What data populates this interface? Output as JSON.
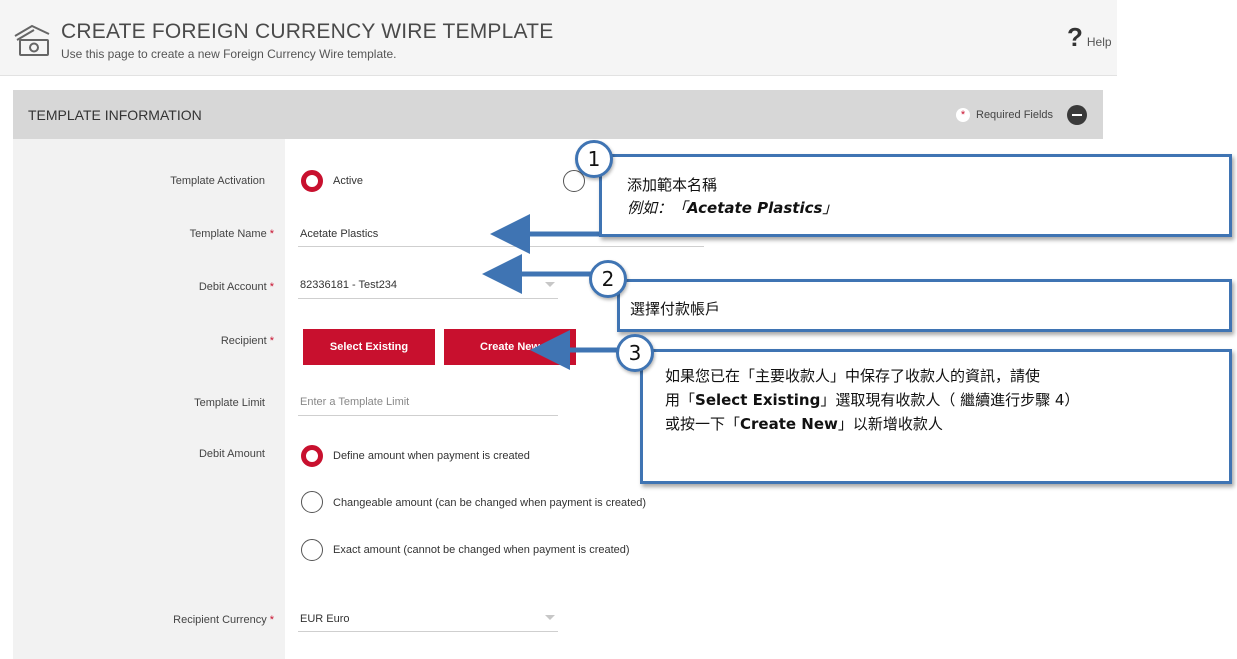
{
  "header": {
    "title": "CREATE FOREIGN CURRENCY WIRE TEMPLATE",
    "subtitle": "Use this page to create a new Foreign Currency Wire template.",
    "help_icon": "?",
    "help_label": "Help"
  },
  "section": {
    "title": "TEMPLATE INFORMATION",
    "required_label": "Required Fields",
    "required_star": "*"
  },
  "form": {
    "activation": {
      "label": "Template Activation",
      "option_active": "Active"
    },
    "template_name": {
      "label": "Template Name",
      "value": "Acetate Plastics"
    },
    "debit_account": {
      "label": "Debit Account",
      "value": "82336181 - Test234"
    },
    "recipient": {
      "label": "Recipient",
      "select_existing": "Select Existing",
      "create_new": "Create New"
    },
    "template_limit": {
      "label": "Template Limit",
      "placeholder": "Enter a Template Limit"
    },
    "debit_amount": {
      "label": "Debit Amount",
      "options": [
        "Define amount when payment is created",
        "Changeable amount (can be changed when payment is created)",
        "Exact amount (cannot be changed when payment is created)"
      ]
    },
    "recipient_currency": {
      "label": "Recipient Currency",
      "value": "EUR Euro"
    },
    "star": "*"
  },
  "callouts": [
    {
      "number": "1",
      "line1": "添加範本名稱",
      "line2_prefix": "例如：「",
      "line2_bold": "Acetate Plastics",
      "line2_suffix": "」"
    },
    {
      "number": "2",
      "text": "選擇付款帳戶"
    },
    {
      "number": "3",
      "line1": "如果您已在「主要收款人」中保存了收款人的資訊，請使",
      "line2_prefix": "用「",
      "line2_bold": "Select Existing",
      "line2_suffix": "」選取現有收款人（ 繼續進行步驟 4）",
      "line3_prefix": "或按一下「",
      "line3_bold": "Create New",
      "line3_suffix": "」以新增收款人"
    }
  ],
  "colors": {
    "accent": "#c8102e",
    "callout_border": "#3f74b3"
  }
}
